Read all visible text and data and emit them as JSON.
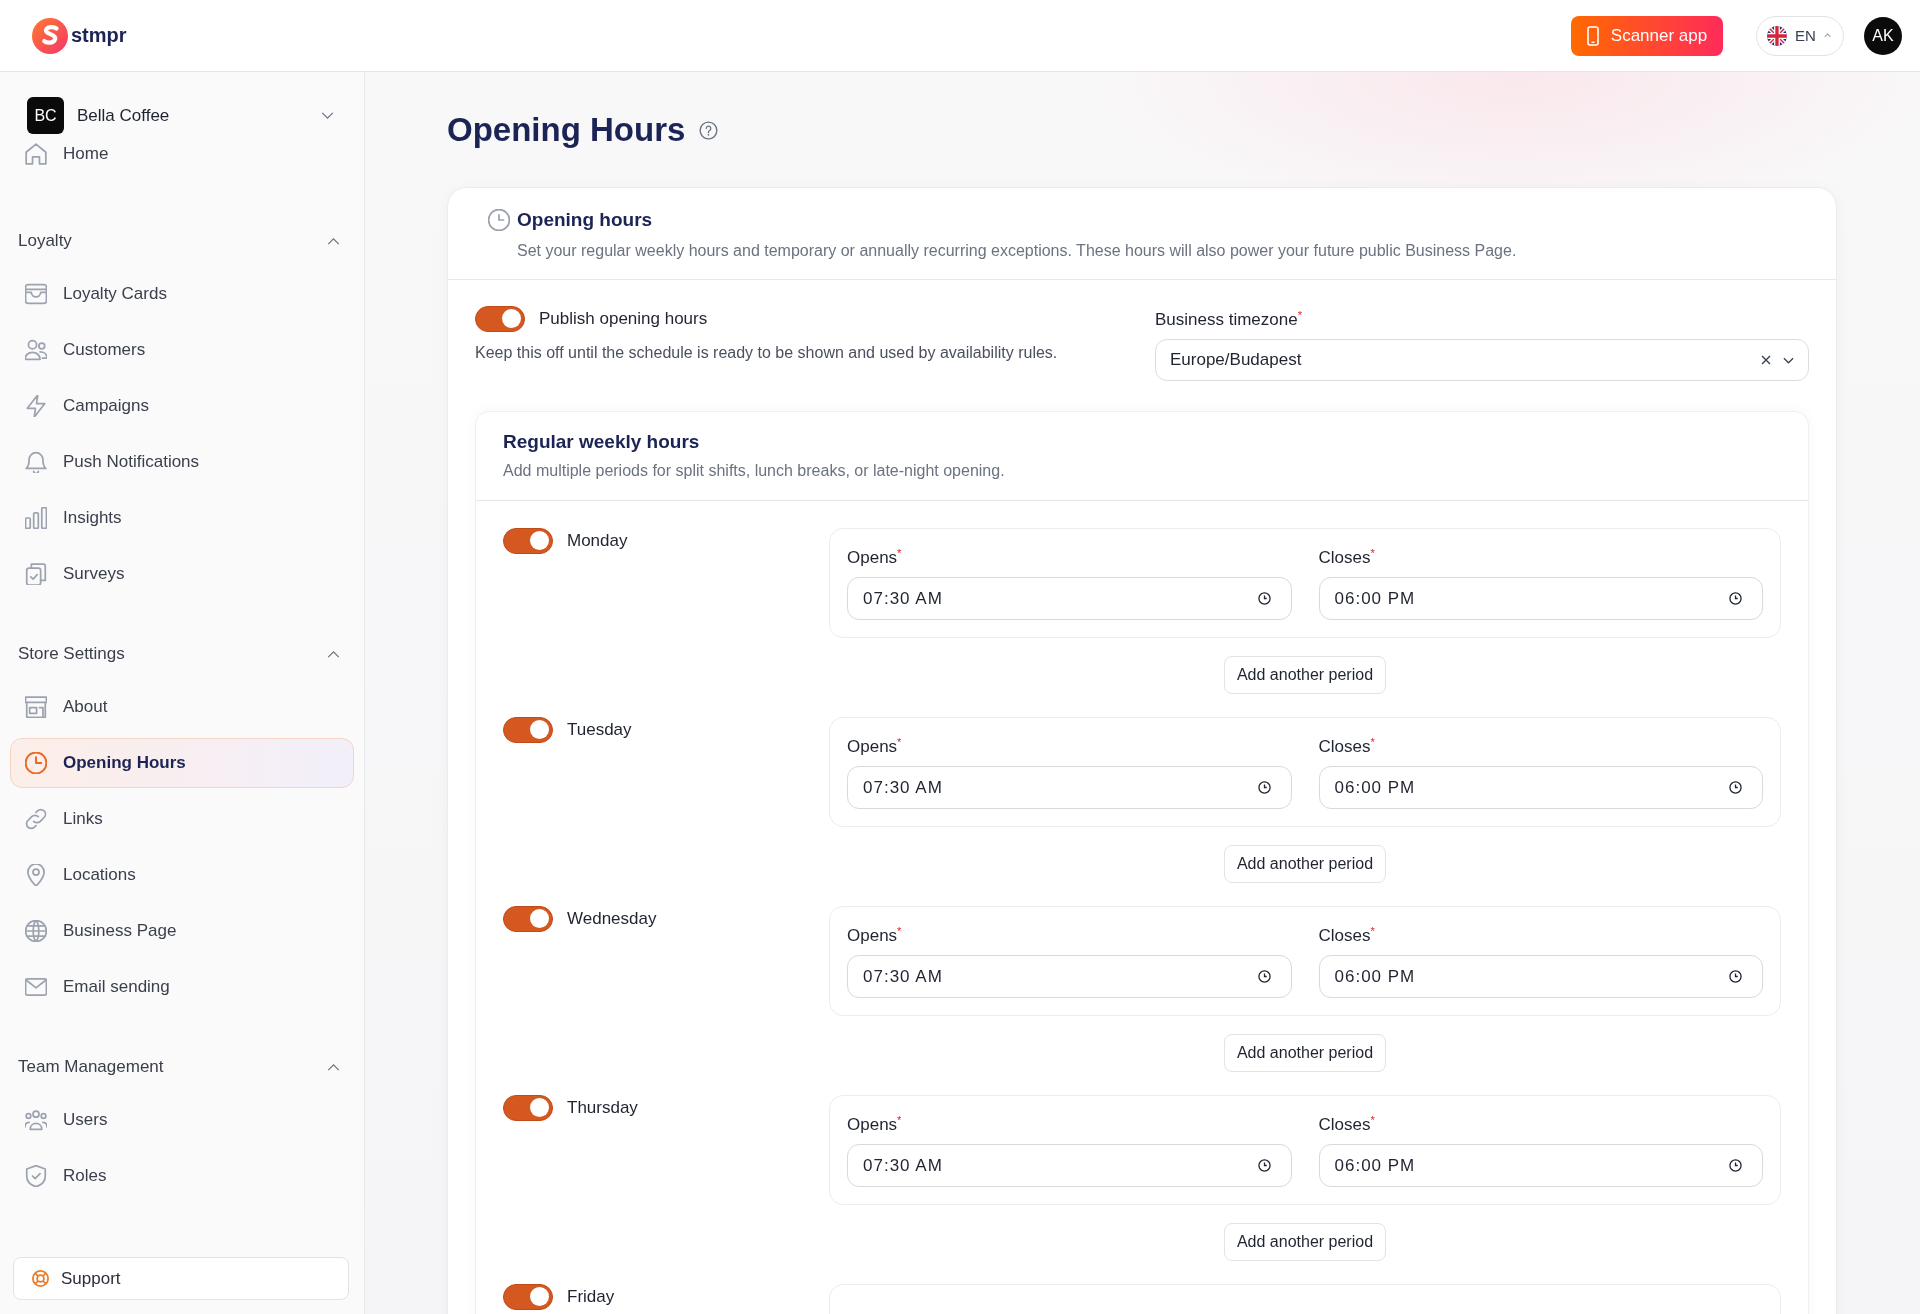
{
  "topbar": {
    "brand": "stmpr",
    "scanner_button": "Scanner app",
    "language": "EN",
    "avatar": "AK"
  },
  "sidebar": {
    "business": {
      "initials": "BC",
      "name": "Bella Coffee"
    },
    "home": {
      "label": "Home",
      "selected": false
    },
    "sections": [
      {
        "title": "Loyalty",
        "expanded": true,
        "items": [
          {
            "label": "Loyalty Cards",
            "selected": false
          },
          {
            "label": "Customers",
            "selected": false
          },
          {
            "label": "Campaigns",
            "selected": false
          },
          {
            "label": "Push Notifications",
            "selected": false
          },
          {
            "label": "Insights",
            "selected": false
          },
          {
            "label": "Surveys",
            "selected": false
          }
        ]
      },
      {
        "title": "Store Settings",
        "expanded": true,
        "items": [
          {
            "label": "About",
            "selected": false
          },
          {
            "label": "Opening Hours",
            "selected": true
          },
          {
            "label": "Links",
            "selected": false
          },
          {
            "label": "Locations",
            "selected": false
          },
          {
            "label": "Business Page",
            "selected": false
          },
          {
            "label": "Email sending",
            "selected": false
          }
        ]
      },
      {
        "title": "Team Management",
        "expanded": true,
        "items": [
          {
            "label": "Users",
            "selected": false
          },
          {
            "label": "Roles",
            "selected": false
          }
        ]
      }
    ],
    "support": "Support"
  },
  "page": {
    "title": "Opening Hours"
  },
  "hours_card": {
    "title": "Opening hours",
    "description": "Set your regular weekly hours and temporary or annually recurring exceptions. These hours will also power your future public Business Page.",
    "publish": {
      "label": "Publish opening hours",
      "on": true,
      "description": "Keep this off until the schedule is ready to be shown and used by availability rules."
    },
    "timezone": {
      "label": "Business timezone$^{*}$",
      "value": "Europe/Budapest"
    },
    "weekly": {
      "title": "Regular weekly hours",
      "description": "Add multiple periods for split shifts, lunch breaks, or late-night opening.",
      "days": [
        {
          "name": "Monday",
          "on": true,
          "periods": [
            {
              "opens_label": "Opens$^{*}$",
              "opens": "07:30 AM",
              "closes_label": "Closes$^{*}$",
              "closes": "06:00 PM"
            }
          ],
          "add_button": "Add another period"
        },
        {
          "name": "Tuesday",
          "on": true,
          "periods": [
            {
              "opens_label": "Opens$^{*}$",
              "opens": "07:30 AM",
              "closes_label": "Closes$^{*}$",
              "closes": "06:00 PM"
            }
          ],
          "add_button": "Add another period"
        },
        {
          "name": "Wednesday",
          "on": true,
          "periods": [
            {
              "opens_label": "Opens$^{*}$",
              "opens": "07:30 AM",
              "closes_label": "Closes$^{*}$",
              "closes": "06:00 PM"
            }
          ],
          "add_button": "Add another period"
        },
        {
          "name": "Thursday",
          "on": true,
          "periods": [
            {
              "opens_label": "Opens$^{*}$",
              "opens": "07:30 AM",
              "closes_label": "Closes$^{*}$",
              "closes": "06:00 PM"
            }
          ],
          "add_button": "Add another period"
        },
        {
          "name": "Friday",
          "on": true
        }
      ]
    }
  }
}
